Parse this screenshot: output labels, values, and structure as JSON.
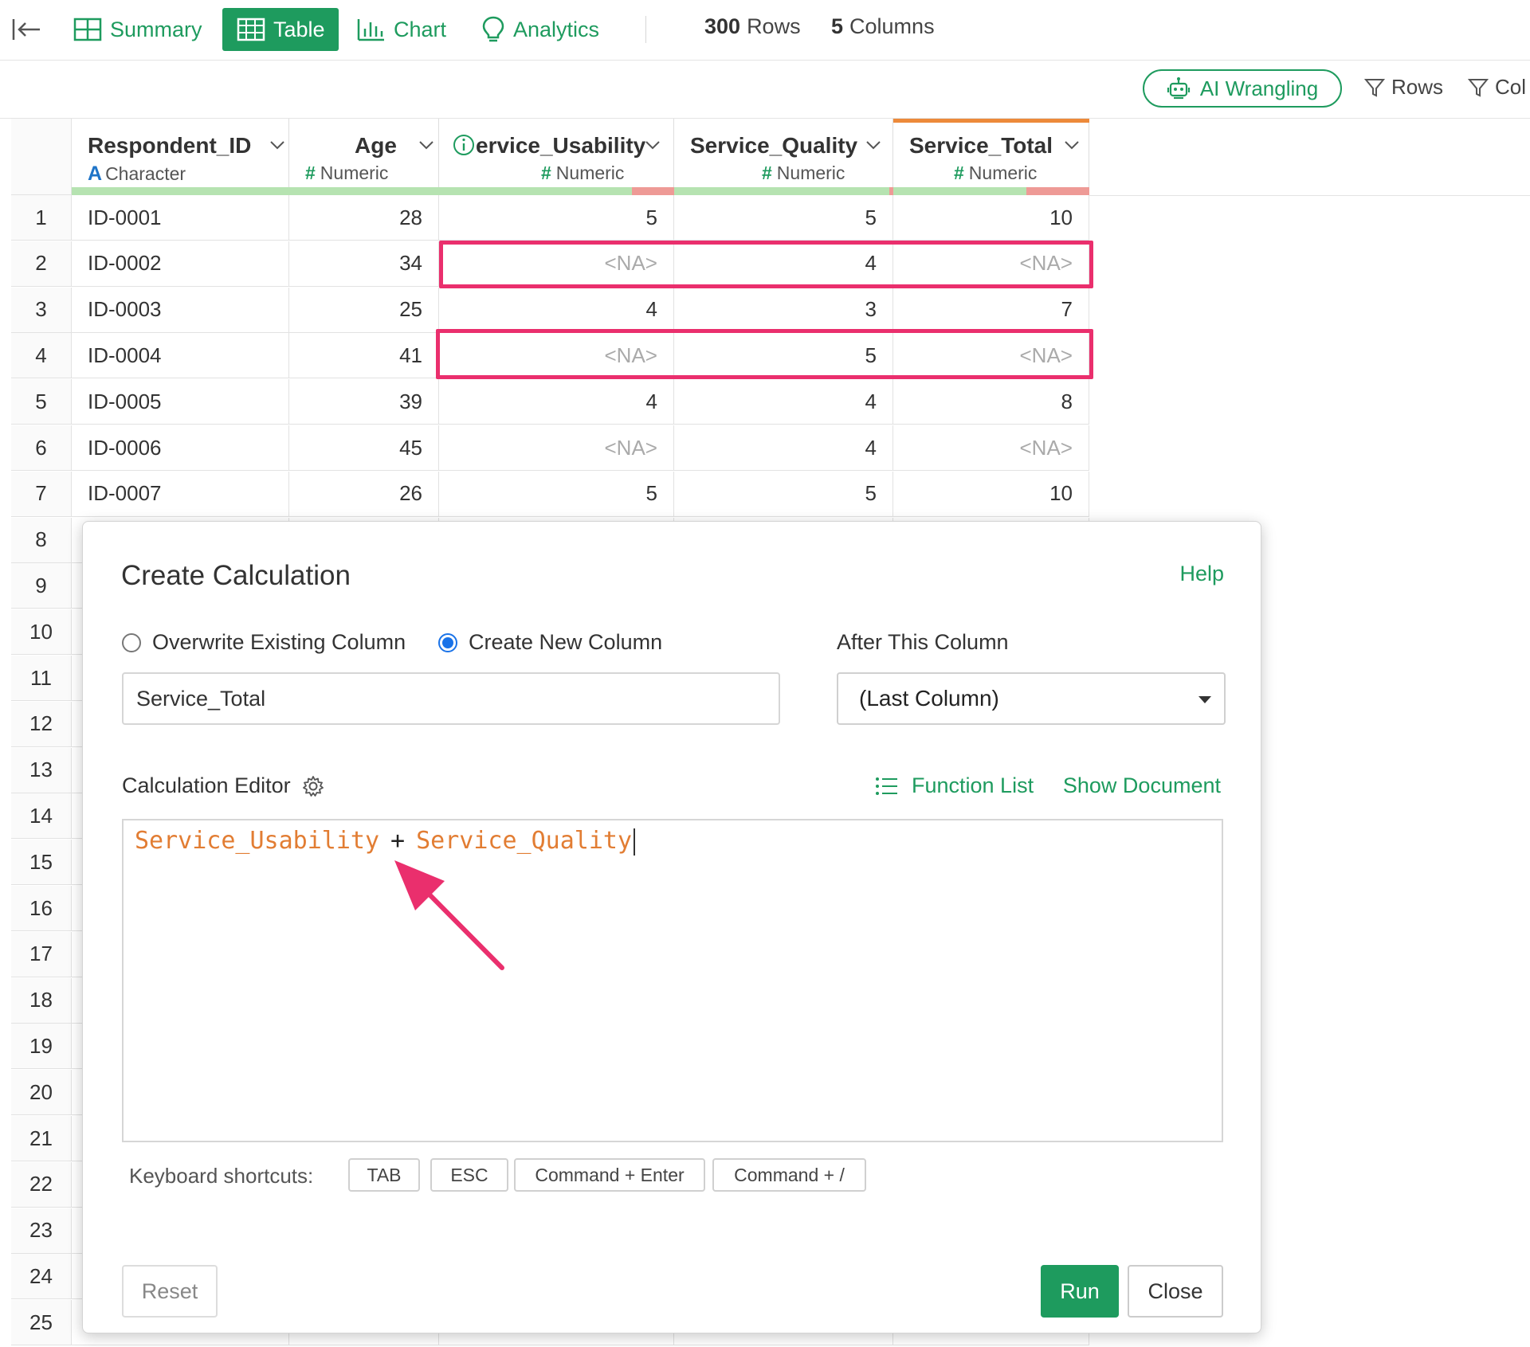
{
  "nav": {
    "tabs": [
      {
        "label": "Summary",
        "icon": "summary-grid-icon"
      },
      {
        "label": "Table",
        "icon": "table-icon"
      },
      {
        "label": "Chart",
        "icon": "bar-chart-icon"
      },
      {
        "label": "Analytics",
        "icon": "lightbulb-icon"
      }
    ],
    "active_tab": "Table",
    "rows_count": "300",
    "rows_label": "Rows",
    "cols_count": "5",
    "cols_label": "Columns"
  },
  "toolbar": {
    "ai_wrangling": "AI Wrangling",
    "rows_filter": "Rows",
    "cols_filter": "Col"
  },
  "table": {
    "columns": [
      {
        "name": "Respondent_ID",
        "type": "Character",
        "type_mark": "A",
        "na_fraction": 0
      },
      {
        "name": "Age",
        "type": "Numeric",
        "type_mark": "#",
        "na_fraction": 0
      },
      {
        "name": "ervice_Usability",
        "type": "Numeric",
        "type_mark": "#",
        "na_fraction": 0.18
      },
      {
        "name": "Service_Quality",
        "type": "Numeric",
        "type_mark": "#",
        "na_fraction": 0.02
      },
      {
        "name": "Service_Total",
        "type": "Numeric",
        "type_mark": "#",
        "na_fraction": 0.32
      }
    ],
    "rows": [
      [
        "ID-0001",
        "28",
        "5",
        "5",
        "10"
      ],
      [
        "ID-0002",
        "34",
        "<NA>",
        "4",
        "<NA>"
      ],
      [
        "ID-0003",
        "25",
        "4",
        "3",
        "7"
      ],
      [
        "ID-0004",
        "41",
        "<NA>",
        "5",
        "<NA>"
      ],
      [
        "ID-0005",
        "39",
        "4",
        "4",
        "8"
      ],
      [
        "ID-0006",
        "45",
        "<NA>",
        "4",
        "<NA>"
      ],
      [
        "ID-0007",
        "26",
        "5",
        "5",
        "10"
      ]
    ],
    "row_numbers": [
      "1",
      "2",
      "3",
      "4",
      "5",
      "6",
      "7",
      "8",
      "9",
      "10",
      "11",
      "12",
      "13",
      "14",
      "15",
      "16",
      "17",
      "18",
      "19",
      "20",
      "21",
      "22",
      "23",
      "24",
      "25"
    ],
    "highlighted_rows": [
      2,
      4
    ],
    "accent_colors": {
      "primary": "#1e9b5e",
      "highlight": "#ea2f6d",
      "selected_column": "#ed8a3a"
    }
  },
  "dialog": {
    "title": "Create Calculation",
    "help": "Help",
    "radio_overwrite": "Overwrite Existing Column",
    "radio_create": "Create New Column",
    "selected_mode": "Create New Column",
    "after_label": "After This Column",
    "column_name_value": "Service_Total",
    "after_select_value": "(Last Column)",
    "editor_label": "Calculation Editor",
    "function_list": "Function List",
    "show_document": "Show Document",
    "expression": {
      "left": "Service_Usability",
      "operator": "+",
      "right": "Service_Quality"
    },
    "shortcuts_label": "Keyboard shortcuts:",
    "shortcuts": [
      "TAB",
      "ESC",
      "Command + Enter",
      "Command + /"
    ],
    "reset": "Reset",
    "run": "Run",
    "close": "Close"
  }
}
